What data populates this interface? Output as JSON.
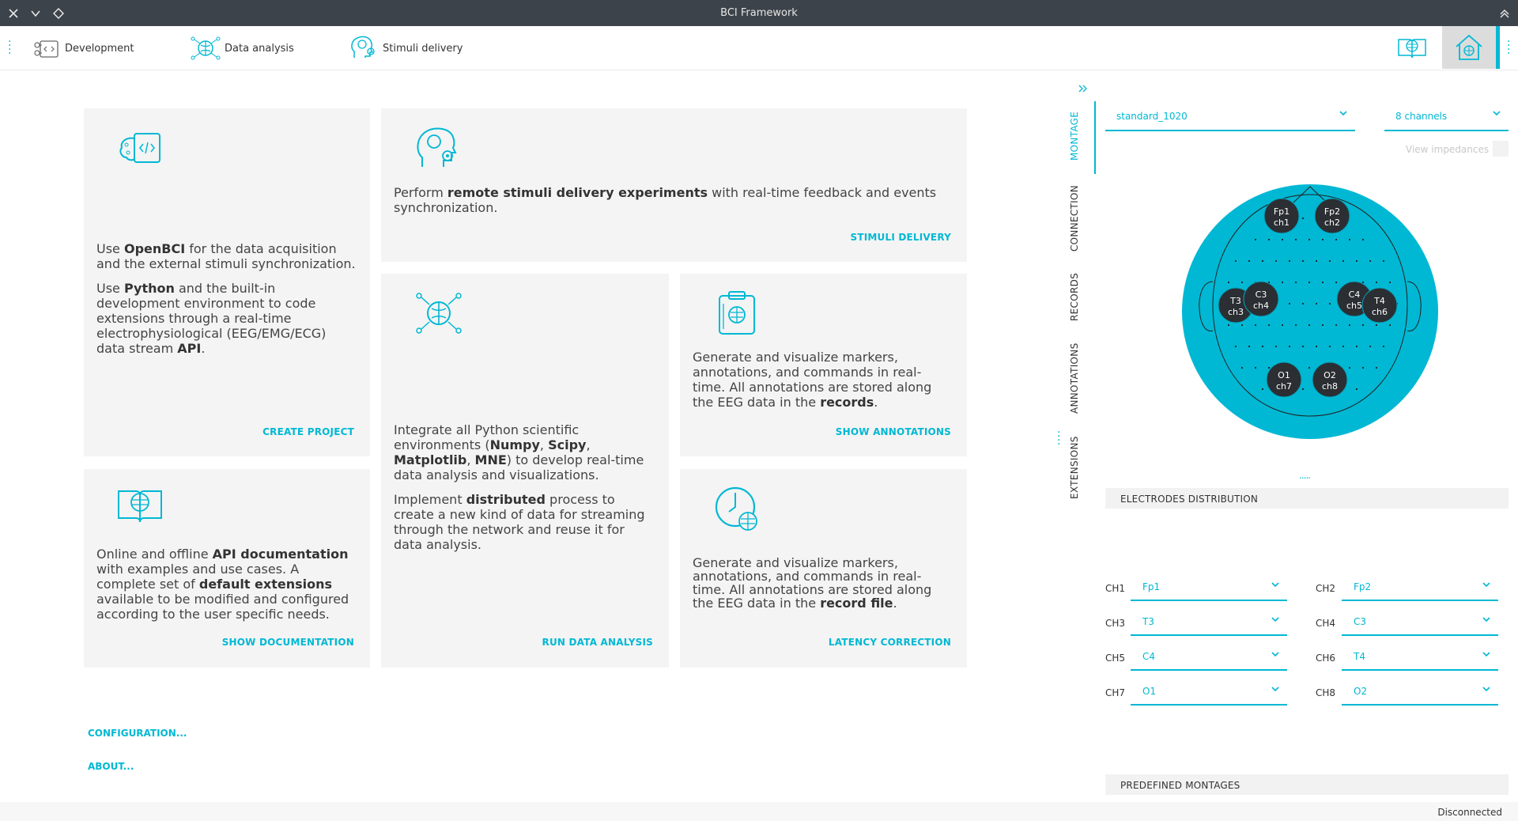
{
  "window": {
    "title": "BCI Framework"
  },
  "toolbar": {
    "development": "Development",
    "data_analysis": "Data analysis",
    "stimuli_delivery": "Stimuli delivery"
  },
  "cards": {
    "openbci": {
      "p1_a": "Use ",
      "p1_b": "OpenBCI",
      "p1_c": " for the data acquisition and the external stimuli synchronization.",
      "p2_a": "Use ",
      "p2_b": "Python",
      "p2_c": " and the built-in development environment to code extensions through a real-time electrophysiological (EEG/EMG/ECG) data stream ",
      "p2_d": "API",
      "p2_e": ".",
      "action": "CREATE PROJECT"
    },
    "stimuli": {
      "a": "Perform ",
      "b": "remote stimuli delivery experiments",
      "c": " with real-time feedback and events synchronization.",
      "action": "STIMULI DELIVERY"
    },
    "analysis": {
      "p1_a": "Integrate all Python scientific environments (",
      "p1_b": "Numpy",
      "p1_c": ", ",
      "p1_d": "Scipy",
      "p1_e": ", ",
      "p1_f": "Matplotlib",
      "p1_g": ", ",
      "p1_h": "MNE",
      "p1_i": ") to develop real-time data analysis and visualizations.",
      "p2_a": "Implement ",
      "p2_b": "distributed",
      "p2_c": " process to create a new kind of data for streaming through the network and reuse it for data analysis.",
      "action": "RUN DATA ANALYSIS"
    },
    "annotations": {
      "a": "Generate and visualize markers, annotations, and commands in real-time. All annotations are stored along the EEG data in the ",
      "b": "records",
      "c": ".",
      "action": "SHOW ANNOTATIONS"
    },
    "documentation": {
      "a": "Online and offline ",
      "b": "API documentation",
      "c": " with examples and use cases. A complete set of ",
      "d": "default extensions",
      "e": " available to be modified and configured according to the user specific needs.",
      "action": "SHOW DOCUMENTATION"
    },
    "latency": {
      "a": "Generate and visualize markers, annotations, and commands in real-time. All annotations are stored along the EEG data in the ",
      "b": "record file",
      "c": ".",
      "action": "LATENCY CORRECTION"
    }
  },
  "links": {
    "configuration": "CONFIGURATION...",
    "about": "ABOUT..."
  },
  "side_tabs": [
    "MONTAGE",
    "CONNECTION",
    "RECORDS",
    "ANNOTATIONS",
    "EXTENSIONS"
  ],
  "montage": {
    "montage_select": "standard_1020",
    "channels_select": "8 channels",
    "view_impedances": "View impedances",
    "electrodes": [
      {
        "name": "Fp1",
        "ch": "ch1"
      },
      {
        "name": "Fp2",
        "ch": "ch2"
      },
      {
        "name": "T3",
        "ch": "ch3"
      },
      {
        "name": "C3",
        "ch": "ch4"
      },
      {
        "name": "C4",
        "ch": "ch5"
      },
      {
        "name": "T4",
        "ch": "ch6"
      },
      {
        "name": "O1",
        "ch": "ch7"
      },
      {
        "name": "O2",
        "ch": "ch8"
      }
    ],
    "more": ".....",
    "electrodes_distribution": "ELECTRODES DISTRIBUTION",
    "channels": [
      {
        "label": "CH1",
        "value": "Fp1"
      },
      {
        "label": "CH2",
        "value": "Fp2"
      },
      {
        "label": "CH3",
        "value": "T3"
      },
      {
        "label": "CH4",
        "value": "C3"
      },
      {
        "label": "CH5",
        "value": "C4"
      },
      {
        "label": "CH6",
        "value": "T4"
      },
      {
        "label": "CH7",
        "value": "O1"
      },
      {
        "label": "CH8",
        "value": "O2"
      }
    ],
    "predefined_montages": "PREDEFINED MONTAGES"
  },
  "status": {
    "connection": "Disconnected"
  },
  "colors": {
    "accent": "#00b8d4",
    "titlebar": "#3d434a",
    "card": "#f4f4f4",
    "electrode": "#2b2f33"
  }
}
